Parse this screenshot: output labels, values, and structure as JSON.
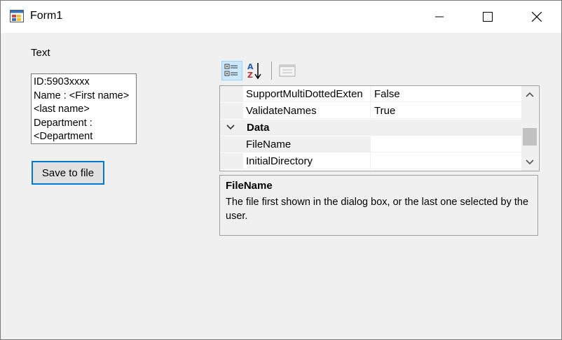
{
  "window": {
    "title": "Form1"
  },
  "form": {
    "label": "Text",
    "textbox_value": "ID:5903xxxx\nName : <First name> <last name>\nDepartment : <Department",
    "save_button": "Save to file"
  },
  "property_grid": {
    "toolbar": [
      "categorized-view",
      "alphabetical-sort",
      "property-pages"
    ],
    "rows": [
      {
        "name": "SupportMultiDottedExtensions",
        "display_name": "SupportMultiDottedExten",
        "value": "False"
      },
      {
        "name": "ValidateNames",
        "display_name": "ValidateNames",
        "value": "True"
      },
      {
        "category": "Data"
      },
      {
        "name": "FileName",
        "display_name": "FileName",
        "value": ""
      },
      {
        "name": "InitialDirectory",
        "display_name": "InitialDirectory",
        "value": ""
      }
    ],
    "help": {
      "title": "FileName",
      "description": "The file first shown in the dialog box, or the last one selected by the user."
    }
  },
  "colors": {
    "focus_border": "#0078d7",
    "selected_toolbar": "#cce8ff",
    "background": "#f0f0f0"
  }
}
